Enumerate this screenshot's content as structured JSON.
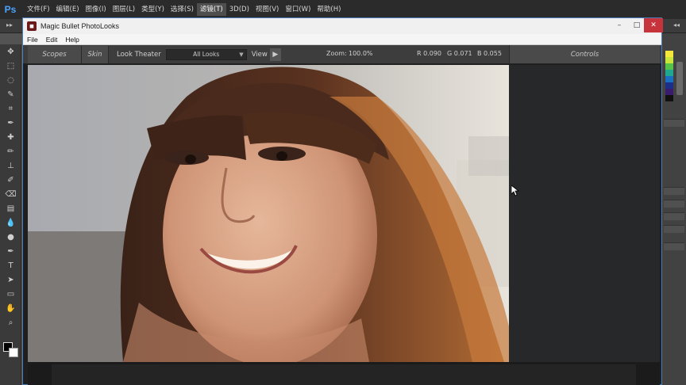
{
  "photoshop": {
    "logo": "Ps",
    "menus": [
      "文件(F)",
      "编辑(E)",
      "图像(I)",
      "图层(L)",
      "类型(Y)",
      "选择(S)",
      "滤镜(T)",
      "3D(D)",
      "视图(V)",
      "窗口(W)",
      "帮助(H)"
    ],
    "active_menu_index": 6,
    "tools": [
      "move-tool",
      "marquee-tool",
      "lasso-tool",
      "quick-select-tool",
      "crop-tool",
      "eyedropper-tool",
      "healing-tool",
      "brush-tool",
      "clone-stamp-tool",
      "history-brush-tool",
      "eraser-tool",
      "gradient-tool",
      "blur-tool",
      "dodge-tool",
      "pen-tool",
      "type-tool",
      "path-select-tool",
      "shape-tool",
      "hand-tool",
      "zoom-tool"
    ],
    "foreground_color": "#000000",
    "background_color": "#ffffff",
    "swatches": [
      "#f4e93b",
      "#c9e43a",
      "#55c24a",
      "#1fa88f",
      "#1b6fc0",
      "#1b2f8a",
      "#3a1c6e",
      "#111111"
    ]
  },
  "photolooks": {
    "window_title": "Magic Bullet PhotoLooks",
    "menus": [
      "File",
      "Edit",
      "Help"
    ],
    "toolbar": {
      "scopes_label": "Scopes",
      "skin_label": "Skin",
      "look_theater_label": "Look Theater",
      "looks_select_value": "All Looks",
      "view_label": "View",
      "zoom_label": "Zoom:",
      "zoom_value": "100.0%",
      "r_value": "R 0.090",
      "g_value": "G 0.071",
      "b_value": "B 0.055",
      "controls_label": "Controls"
    },
    "window_buttons": {
      "minimize": "–",
      "maximize": "□",
      "close": "✕"
    },
    "colors": {
      "titlebar": "#f0f0f0",
      "close_button": "#c7333a",
      "panel_bg": "#262829"
    }
  }
}
